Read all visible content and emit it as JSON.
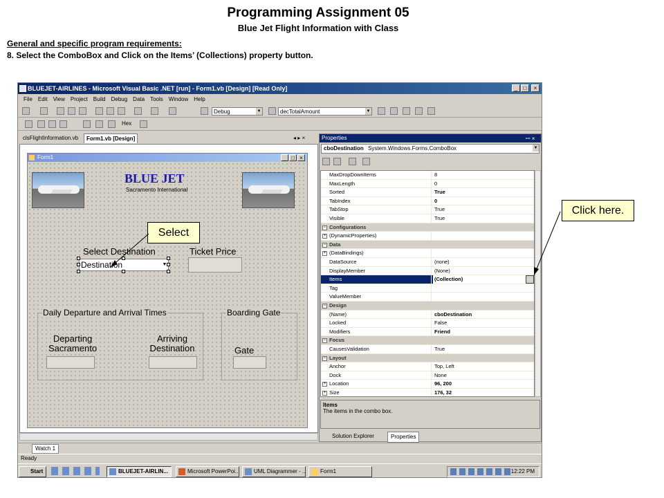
{
  "slide": {
    "title": "Programming Assignment 05",
    "subtitle": "Blue Jet Flight Information with Class",
    "req_heading": "General  and specific program requirements:",
    "req_step": "8.  Select the ComboBox and Click on the Items’ (Collections) property button."
  },
  "ide": {
    "title": "BLUEJET-AIRLINES - Microsoft Visual Basic .NET [run] - Form1.vb [Design] [Read Only]",
    "menu": [
      "File",
      "Edit",
      "View",
      "Project",
      "Build",
      "Debug",
      "Data",
      "Tools",
      "Window",
      "Help"
    ],
    "config_combo": "Debug",
    "find_combo": "decTotalAmount",
    "hex_label": "Hex",
    "tabs": [
      "clsFlightInformation.vb",
      "Form1.vb [Design]"
    ],
    "doc_nav": "◂ ▸ ×"
  },
  "form": {
    "title": "Form1",
    "logo_title": "BLUE JET",
    "logo_sub": "Sacramento International",
    "select_dest_label": "Select Destination",
    "ticket_price_label": "Ticket Price",
    "combo_value": "Destination",
    "group_times": "Daily Departure and Arrival Times",
    "group_gate": "Boarding Gate",
    "departing_label": "Departing\nSacramento",
    "arriving_label": "Arriving\nDestination",
    "gate_label": "Gate"
  },
  "properties": {
    "title": "Properties",
    "object_name": "cboDestination",
    "object_type": "System.Windows.Forms.ComboBox",
    "rows": [
      {
        "kind": "prop",
        "name": "MaxDropDownItems",
        "value": "8",
        "bold": false
      },
      {
        "kind": "prop",
        "name": "MaxLength",
        "value": "0",
        "bold": false
      },
      {
        "kind": "prop",
        "name": "Sorted",
        "value": "True",
        "bold": true
      },
      {
        "kind": "prop",
        "name": "TabIndex",
        "value": "0",
        "bold": true
      },
      {
        "kind": "prop",
        "name": "TabStop",
        "value": "True",
        "bold": false
      },
      {
        "kind": "prop",
        "name": "Visible",
        "value": "True",
        "bold": false
      },
      {
        "kind": "cat",
        "name": "Configurations",
        "value": ""
      },
      {
        "kind": "sub",
        "name": "(DynamicProperties)",
        "value": ""
      },
      {
        "kind": "cat",
        "name": "Data",
        "value": ""
      },
      {
        "kind": "sub",
        "name": "(DataBindings)",
        "value": ""
      },
      {
        "kind": "prop",
        "name": "DataSource",
        "value": "(none)",
        "bold": false
      },
      {
        "kind": "prop",
        "name": "DisplayMember",
        "value": "(None)",
        "bold": false
      },
      {
        "kind": "sel",
        "name": "Items",
        "value": "(Collection)",
        "bold": true
      },
      {
        "kind": "prop",
        "name": "Tag",
        "value": "",
        "bold": false
      },
      {
        "kind": "prop",
        "name": "ValueMember",
        "value": "",
        "bold": false
      },
      {
        "kind": "cat",
        "name": "Design",
        "value": ""
      },
      {
        "kind": "prop",
        "name": "(Name)",
        "value": "cboDestination",
        "bold": true
      },
      {
        "kind": "prop",
        "name": "Locked",
        "value": "False",
        "bold": false
      },
      {
        "kind": "prop",
        "name": "Modifiers",
        "value": "Friend",
        "bold": true
      },
      {
        "kind": "cat",
        "name": "Focus",
        "value": ""
      },
      {
        "kind": "prop",
        "name": "CausesValidation",
        "value": "True",
        "bold": false
      },
      {
        "kind": "cat",
        "name": "Layout",
        "value": ""
      },
      {
        "kind": "prop",
        "name": "Anchor",
        "value": "Top, Left",
        "bold": false
      },
      {
        "kind": "prop",
        "name": "Dock",
        "value": "None",
        "bold": false
      },
      {
        "kind": "sub",
        "name": "Location",
        "value": "96, 200",
        "bold": true
      },
      {
        "kind": "sub",
        "name": "Size",
        "value": "176, 32",
        "bold": true
      }
    ],
    "ellipsis": "...",
    "desc_title": "Items",
    "desc_text": "The items in the combo box.",
    "tab_solution": "Solution Explorer",
    "tab_properties": "Properties"
  },
  "bottom": {
    "watch_tab": "Watch 1",
    "status": "Ready",
    "start": "Start",
    "tasks": [
      "BLUEJET-AIRLIN...",
      "Microsoft PowerPoi...",
      "UML Diagrammer - ...",
      "Form1"
    ],
    "clock": "12:22 PM"
  },
  "callouts": {
    "select": "Select",
    "click_here": "Click here."
  },
  "colors": {
    "titlebar": "#0a246a",
    "selection": "#0a246a",
    "callout_bg": "#ffffcc",
    "logo_blue": "#1a1aa6"
  }
}
